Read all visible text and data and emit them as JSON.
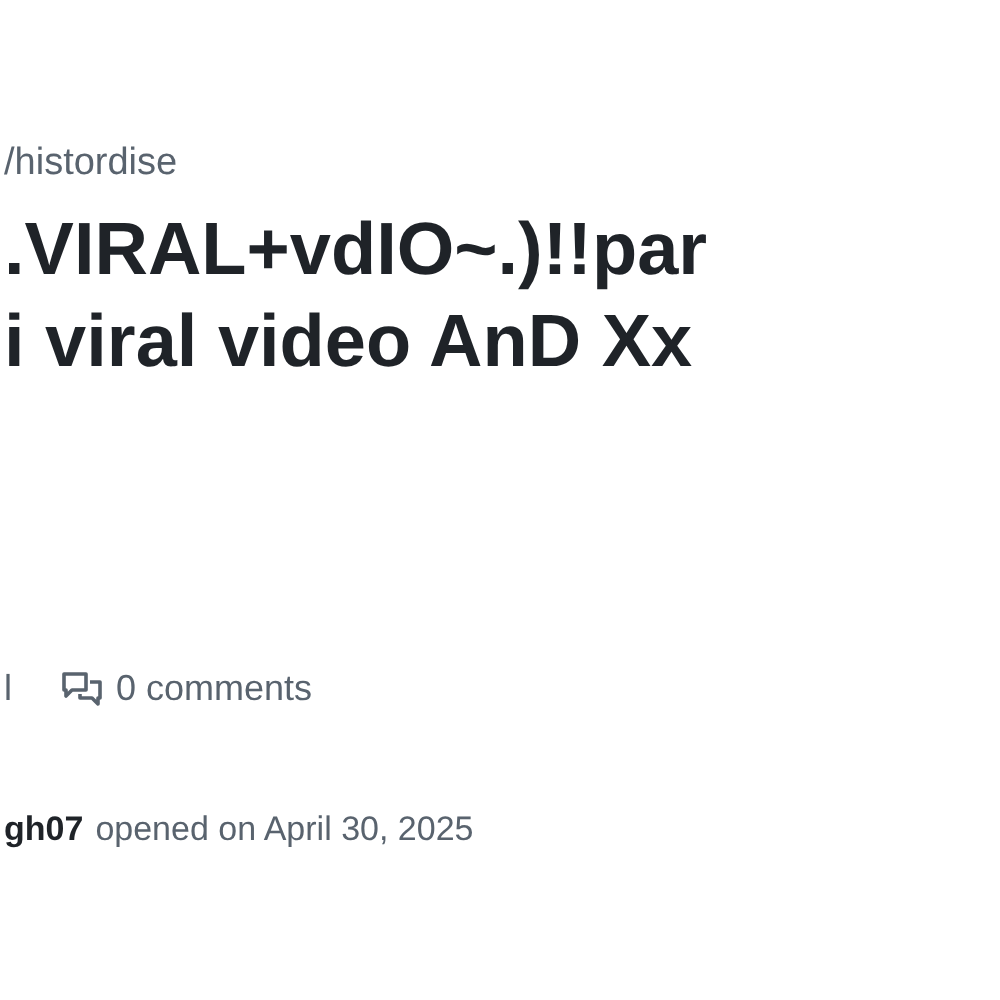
{
  "breadcrumb": "/histordise",
  "title_lines": [
    ".VIRAL+vdIO~.)!!par",
    "i viral video AnD Xx"
  ],
  "meta": {
    "fragment": "l",
    "comments": "0 comments"
  },
  "opened": {
    "author": "gh07",
    "text": "opened on April 30, 2025"
  }
}
